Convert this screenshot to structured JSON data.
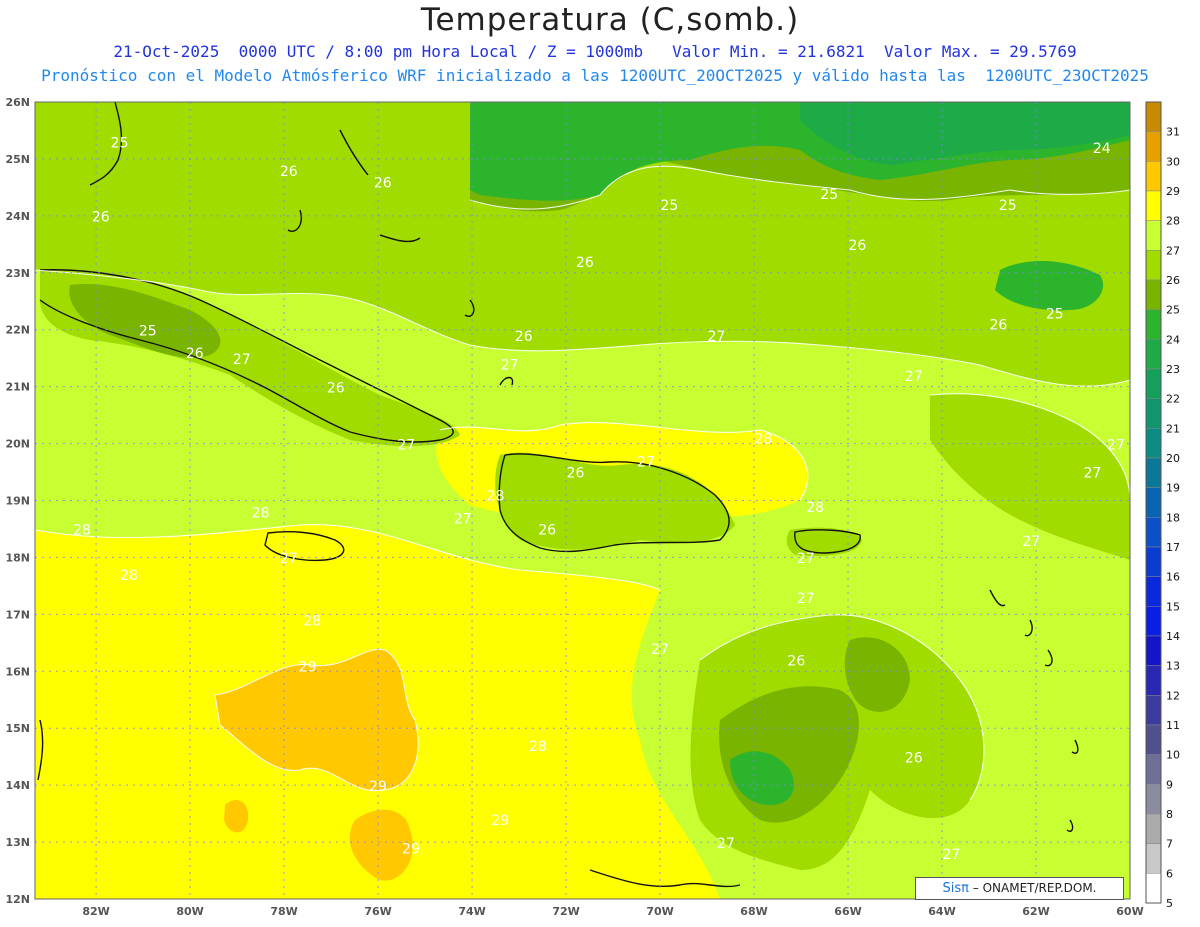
{
  "header": {
    "title": "Temperatura (C,somb.)",
    "line1": "21-Oct-2025  0000 UTC / 8:00 pm Hora Local / Z = 1000mb   Valor Min. = 21.6821  Valor Max. = 29.5769",
    "line2": "Pronóstico con el Modelo Atmósferico WRF inicializado a las 1200UTC_20OCT2025 y válido hasta las  1200UTC_23OCT2025"
  },
  "axes": {
    "lat_labels": [
      "26N",
      "25N",
      "24N",
      "23N",
      "22N",
      "21N",
      "20N",
      "19N",
      "18N",
      "17N",
      "16N",
      "15N",
      "14N",
      "13N",
      "12N"
    ],
    "lon_labels": [
      "82W",
      "80W",
      "78W",
      "76W",
      "74W",
      "72W",
      "70W",
      "68W",
      "66W",
      "64W",
      "62W",
      "60W"
    ]
  },
  "colorbar": {
    "labels": [
      "31",
      "30",
      "29",
      "28",
      "27",
      "26",
      "25",
      "24",
      "23",
      "22",
      "21",
      "20",
      "19",
      "18",
      "17",
      "16",
      "15",
      "14",
      "13",
      "12",
      "11",
      "10",
      "9",
      "8",
      "7",
      "6",
      "5"
    ],
    "colors": [
      "#c88a00",
      "#e6a000",
      "#ffc800",
      "#ffff00",
      "#c8ff32",
      "#a0dc00",
      "#78b400",
      "#2db42d",
      "#1eaa46",
      "#14a05a",
      "#0f966e",
      "#0a8c82",
      "#0a7896",
      "#0a64b4",
      "#0a50c8",
      "#0a3cd2",
      "#0a28dc",
      "#0a1ee6",
      "#1414c8",
      "#2828b4",
      "#3c3ca0",
      "#50508c",
      "#6e6e96",
      "#8c8ca0",
      "#aaaaaa",
      "#c8c8c8",
      "#ffffff"
    ]
  },
  "contour_labels": [
    {
      "text": "25",
      "lon": -81.5,
      "lat": 25.2
    },
    {
      "text": "26",
      "lon": -77.9,
      "lat": 24.7
    },
    {
      "text": "26",
      "lon": -75.9,
      "lat": 24.5
    },
    {
      "text": "26",
      "lon": -81.9,
      "lat": 23.9
    },
    {
      "text": "25",
      "lon": -69.8,
      "lat": 24.1
    },
    {
      "text": "25",
      "lon": -66.4,
      "lat": 24.3
    },
    {
      "text": "25",
      "lon": -62.6,
      "lat": 24.1
    },
    {
      "text": "24",
      "lon": -60.6,
      "lat": 25.1
    },
    {
      "text": "26",
      "lon": -65.8,
      "lat": 23.4
    },
    {
      "text": "26",
      "lon": -71.6,
      "lat": 23.1
    },
    {
      "text": "26",
      "lon": -62.8,
      "lat": 22.0
    },
    {
      "text": "25",
      "lon": -61.6,
      "lat": 22.2
    },
    {
      "text": "25",
      "lon": -80.9,
      "lat": 21.9
    },
    {
      "text": "26",
      "lon": -72.9,
      "lat": 21.8
    },
    {
      "text": "26",
      "lon": -79.9,
      "lat": 21.5
    },
    {
      "text": "27",
      "lon": -78.9,
      "lat": 21.4
    },
    {
      "text": "27",
      "lon": -73.2,
      "lat": 21.3
    },
    {
      "text": "27",
      "lon": -68.8,
      "lat": 21.8
    },
    {
      "text": "27",
      "lon": -64.6,
      "lat": 21.1
    },
    {
      "text": "26",
      "lon": -76.9,
      "lat": 20.9
    },
    {
      "text": "27",
      "lon": -75.4,
      "lat": 19.9
    },
    {
      "text": "28",
      "lon": -67.8,
      "lat": 20.0
    },
    {
      "text": "26",
      "lon": -71.8,
      "lat": 19.4
    },
    {
      "text": "27",
      "lon": -70.3,
      "lat": 19.6
    },
    {
      "text": "27",
      "lon": -60.3,
      "lat": 19.9
    },
    {
      "text": "27",
      "lon": -60.8,
      "lat": 19.4
    },
    {
      "text": "28",
      "lon": -73.5,
      "lat": 19.0
    },
    {
      "text": "28",
      "lon": -78.5,
      "lat": 18.7
    },
    {
      "text": "28",
      "lon": -66.7,
      "lat": 18.8
    },
    {
      "text": "27",
      "lon": -74.2,
      "lat": 18.6
    },
    {
      "text": "26",
      "lon": -72.4,
      "lat": 18.4
    },
    {
      "text": "27",
      "lon": -62.1,
      "lat": 18.2
    },
    {
      "text": "28",
      "lon": -82.3,
      "lat": 18.4
    },
    {
      "text": "27",
      "lon": -77.9,
      "lat": 17.9
    },
    {
      "text": "27",
      "lon": -66.9,
      "lat": 17.9
    },
    {
      "text": "28",
      "lon": -81.3,
      "lat": 17.6
    },
    {
      "text": "27",
      "lon": -66.9,
      "lat": 17.2
    },
    {
      "text": "28",
      "lon": -77.4,
      "lat": 16.8
    },
    {
      "text": "27",
      "lon": -70.0,
      "lat": 16.3
    },
    {
      "text": "26",
      "lon": -67.1,
      "lat": 16.1
    },
    {
      "text": "29",
      "lon": -77.5,
      "lat": 16.0
    },
    {
      "text": "28",
      "lon": -72.6,
      "lat": 14.6
    },
    {
      "text": "29",
      "lon": -76.0,
      "lat": 13.9
    },
    {
      "text": "26",
      "lon": -64.6,
      "lat": 14.4
    },
    {
      "text": "29",
      "lon": -73.4,
      "lat": 13.3
    },
    {
      "text": "27",
      "lon": -68.6,
      "lat": 12.9
    },
    {
      "text": "29",
      "lon": -75.3,
      "lat": 12.8
    },
    {
      "text": "27",
      "lon": -63.8,
      "lat": 12.7
    }
  ],
  "credit": {
    "brand": "Sisπ",
    "text": "– ONAMET/REP.DOM."
  }
}
